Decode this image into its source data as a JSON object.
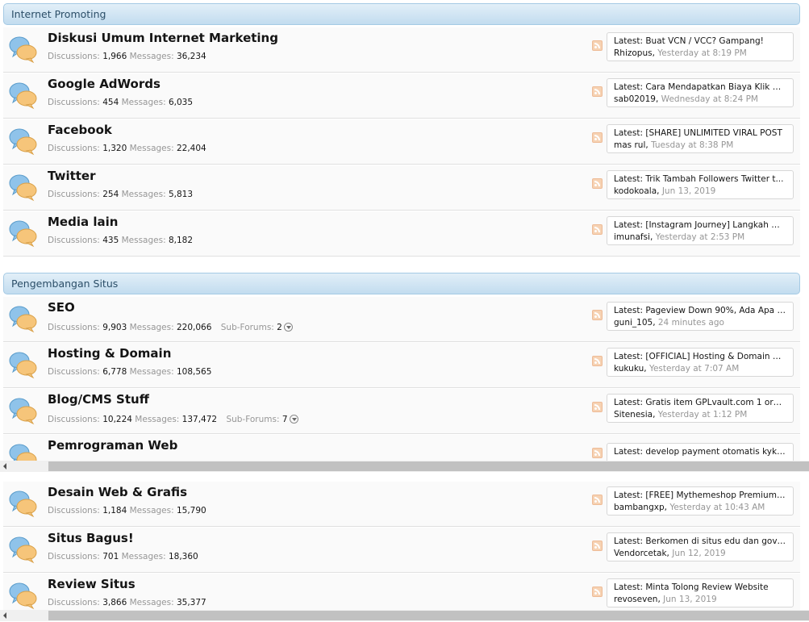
{
  "categories": [
    {
      "title": "Internet Promoting",
      "forums": [
        {
          "title": "Diskusi Umum Internet Marketing",
          "discussions": "1,966",
          "messages": "36,234",
          "latest_title": "Buat VCN / VCC? Gampang!",
          "latest_user": "Rhizopus",
          "latest_time": "Yesterday at 8:19 PM"
        },
        {
          "title": "Google AdWords",
          "discussions": "454",
          "messages": "6,035",
          "latest_title": "Cara Mendapatkan Biaya Klik Mur...",
          "latest_user": "sab02019",
          "latest_time": "Wednesday at 8:24 PM"
        },
        {
          "title": "Facebook",
          "discussions": "1,320",
          "messages": "22,404",
          "latest_title": "[SHARE] UNLIMITED VIRAL POST",
          "latest_user": "mas rul",
          "latest_time": "Tuesday at 8:38 PM"
        },
        {
          "title": "Twitter",
          "discussions": "254",
          "messages": "5,813",
          "latest_title": "Trik Tambah Followers Twitter t...",
          "latest_user": "kodokoala",
          "latest_time": "Jun 13, 2019"
        },
        {
          "title": "Media lain",
          "discussions": "435",
          "messages": "8,182",
          "latest_title": "[Instagram Journey] Langkah Me...",
          "latest_user": "imunafsi",
          "latest_time": "Yesterday at 2:53 PM"
        }
      ]
    },
    {
      "title": "Pengembangan Situs",
      "forums": [
        {
          "title": "SEO",
          "discussions": "9,903",
          "messages": "220,066",
          "subforums": "2",
          "latest_title": "Pageview Down 90%, Ada Apa Ge...",
          "latest_user": "guni_105",
          "latest_time": "24 minutes ago"
        },
        {
          "title": "Hosting & Domain",
          "discussions": "6,778",
          "messages": "108,565",
          "latest_title": "[OFFICIAL] Hosting & Domain Co...",
          "latest_user": "kukuku",
          "latest_time": "Yesterday at 7:07 AM"
        },
        {
          "title": "Blog/CMS Stuff",
          "discussions": "10,224",
          "messages": "137,472",
          "subforums": "7",
          "latest_title": "Gratis item GPLvault.com 1 oran...",
          "latest_user": "Sitenesia",
          "latest_time": "Yesterday at 1:12 PM"
        },
        {
          "title": "Pemrograman Web",
          "latest_title": "develop payment otomatis kyk t..."
        },
        {
          "title": "Desain Web & Grafis",
          "discussions": "1,184",
          "messages": "15,790",
          "latest_title": "[FREE] Mythemeshop Premium T...",
          "latest_user": "bambangxp",
          "latest_time": "Yesterday at 10:43 AM"
        },
        {
          "title": "Situs Bagus!",
          "discussions": "701",
          "messages": "18,360",
          "latest_title": "Berkomen di situs edu dan gov u...",
          "latest_user": "Vendorcetak",
          "latest_time": "Jun 12, 2019"
        },
        {
          "title": "Review Situs",
          "discussions": "3,866",
          "messages": "35,377",
          "latest_title": "Minta Tolong Review Website",
          "latest_user": "revoseven",
          "latest_time": "Jun 13, 2019"
        }
      ]
    }
  ],
  "labels": {
    "discussions": "Discussions:",
    "messages": "Messages:",
    "subforums": "Sub-Forums:",
    "latest": "Latest:"
  },
  "colors": {
    "header_text": "#2b4e68",
    "header_border": "#a5cae4",
    "muted_text": "#969696",
    "icon_blue": "#8fc3ea",
    "icon_orange": "#f6c57a"
  }
}
